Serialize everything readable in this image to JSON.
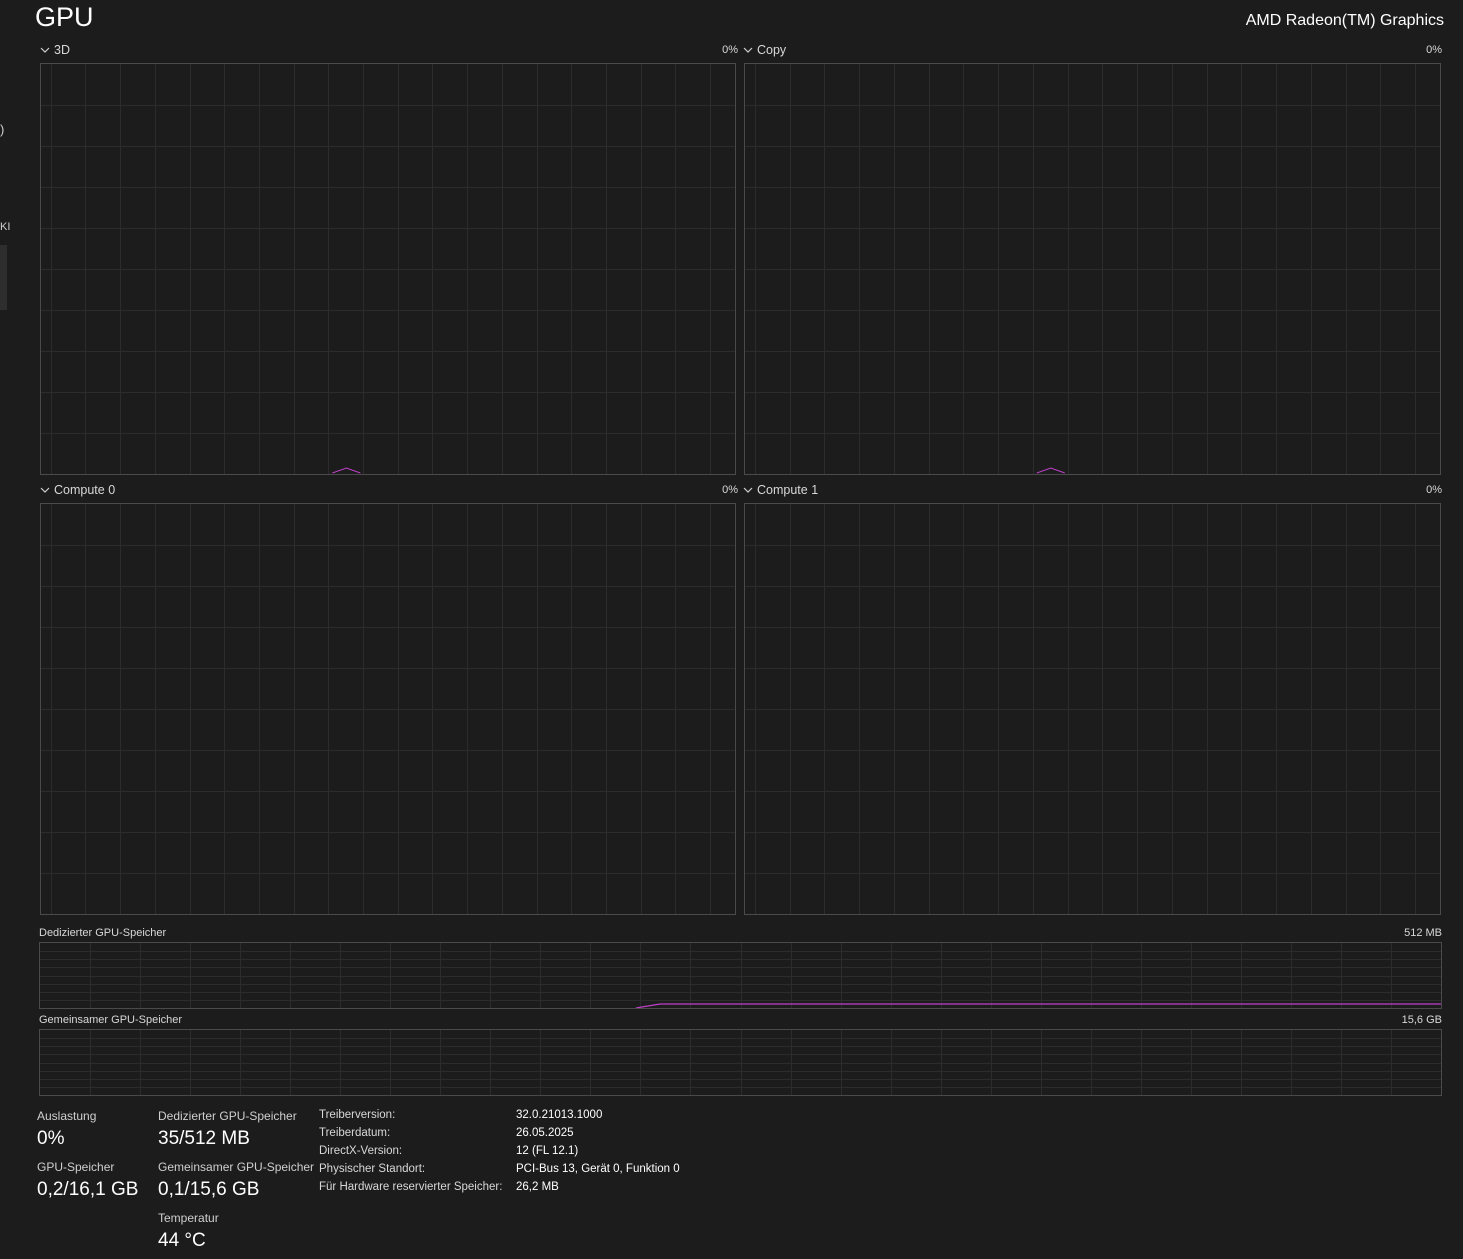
{
  "header": {
    "title": "GPU",
    "gpu_name": "AMD Radeon(TM) Graphics"
  },
  "left_fragments": [
    ")",
    "KI"
  ],
  "engines": [
    {
      "label": "3D",
      "percent": "0%",
      "spike": "small"
    },
    {
      "label": "Copy",
      "percent": "0%",
      "spike": "small"
    },
    {
      "label": "Compute 0",
      "percent": "0%",
      "spike": "none"
    },
    {
      "label": "Compute 1",
      "percent": "0%",
      "spike": "none"
    }
  ],
  "memory_graphs": {
    "dedicated": {
      "label": "Dedizierter GPU-Speicher",
      "max": "512 MB"
    },
    "shared": {
      "label": "Gemeinsamer GPU-Speicher",
      "max": "15,6 GB"
    }
  },
  "stats": {
    "utilization": {
      "label": "Auslastung",
      "value": "0%"
    },
    "gpu_memory": {
      "label": "GPU-Speicher",
      "value": "0,2/16,1 GB"
    },
    "dedicated": {
      "label": "Dedizierter GPU-Speicher",
      "value": "35/512 MB"
    },
    "shared": {
      "label": "Gemeinsamer GPU-Speicher",
      "value": "0,1/15,6 GB"
    },
    "temperature": {
      "label": "Temperatur",
      "value": "44 °C"
    }
  },
  "info": [
    {
      "label": "Treiberversion:",
      "value": "32.0.21013.1000"
    },
    {
      "label": "Treiberdatum:",
      "value": "26.05.2025"
    },
    {
      "label": "DirectX-Version:",
      "value": "12 (FL 12.1)"
    },
    {
      "label": "Physischer Standort:",
      "value": "PCI-Bus 13, Gerät 0, Funktion 0"
    },
    {
      "label": "Für Hardware reservierter Speicher:",
      "value": "26,2 MB"
    }
  ],
  "colors": {
    "background": "#1c1c1c",
    "grid": "#2c2c2c",
    "border": "#4a4a4a",
    "accent": "#c040c8"
  }
}
